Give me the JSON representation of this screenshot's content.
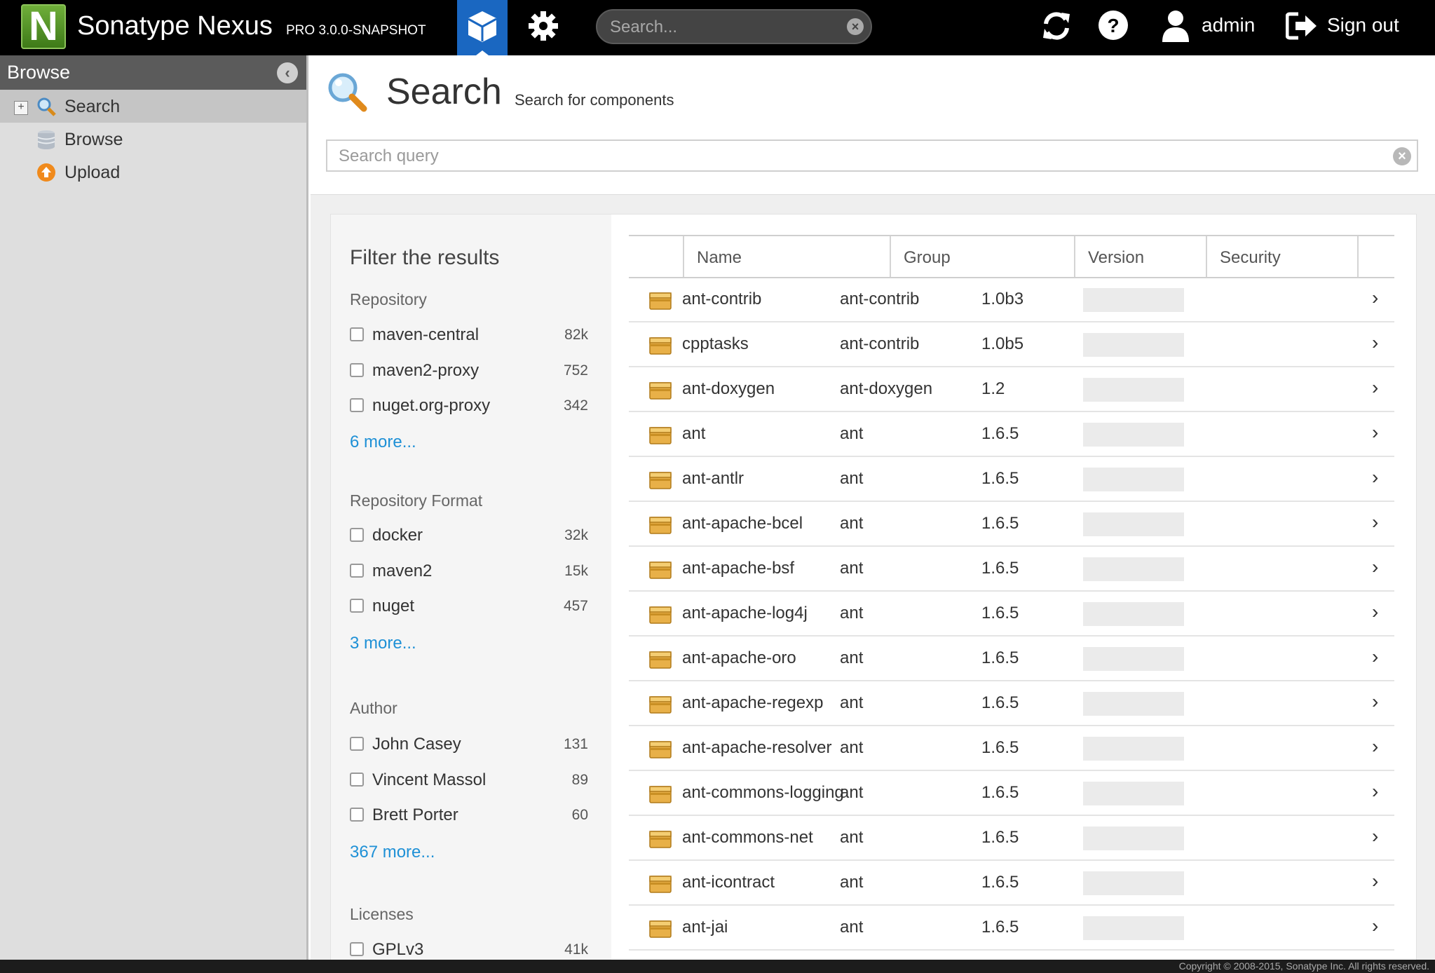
{
  "app": {
    "logo_letter": "N",
    "name": "Sonatype Nexus",
    "version": "PRO 3.0.0-SNAPSHOT"
  },
  "topbar": {
    "search_placeholder": "Search...",
    "user": "admin",
    "signout": "Sign out"
  },
  "sidebar": {
    "title": "Browse",
    "items": [
      {
        "label": "Search",
        "icon": "magnifier-icon",
        "selected": true
      },
      {
        "label": "Browse",
        "icon": "database-icon",
        "selected": false
      },
      {
        "label": "Upload",
        "icon": "upload-icon",
        "selected": false
      }
    ]
  },
  "main": {
    "title": "Search",
    "subtitle": "Search for components",
    "query_placeholder": "Search query"
  },
  "filters": {
    "title": "Filter the results",
    "groups": [
      {
        "name": "Repository",
        "options": [
          {
            "name": "maven-central",
            "count": "82k"
          },
          {
            "name": "maven2-proxy",
            "count": "752"
          },
          {
            "name": "nuget.org-proxy",
            "count": "342"
          }
        ],
        "more": "6 more..."
      },
      {
        "name": "Repository Format",
        "options": [
          {
            "name": "docker",
            "count": "32k"
          },
          {
            "name": "maven2",
            "count": "15k"
          },
          {
            "name": "nuget",
            "count": "457"
          }
        ],
        "more": "3 more..."
      },
      {
        "name": "Author",
        "options": [
          {
            "name": "John Casey",
            "count": "131"
          },
          {
            "name": "Vincent Massol",
            "count": "89"
          },
          {
            "name": "Brett Porter",
            "count": "60"
          }
        ],
        "more": "367 more..."
      },
      {
        "name": "Licenses",
        "options": [
          {
            "name": "GPLv3",
            "count": "41k"
          }
        ],
        "more": ""
      }
    ]
  },
  "results": {
    "columns": [
      "Name",
      "Group",
      "Version",
      "Security"
    ],
    "rows": [
      {
        "name": "ant-contrib",
        "group": "ant-contrib",
        "version": "1.0b3"
      },
      {
        "name": "cpptasks",
        "group": "ant-contrib",
        "version": "1.0b5"
      },
      {
        "name": "ant-doxygen",
        "group": "ant-doxygen",
        "version": "1.2"
      },
      {
        "name": "ant",
        "group": "ant",
        "version": "1.6.5"
      },
      {
        "name": "ant-antlr",
        "group": "ant",
        "version": "1.6.5"
      },
      {
        "name": "ant-apache-bcel",
        "group": "ant",
        "version": "1.6.5"
      },
      {
        "name": "ant-apache-bsf",
        "group": "ant",
        "version": "1.6.5"
      },
      {
        "name": "ant-apache-log4j",
        "group": "ant",
        "version": "1.6.5"
      },
      {
        "name": "ant-apache-oro",
        "group": "ant",
        "version": "1.6.5"
      },
      {
        "name": "ant-apache-regexp",
        "group": "ant",
        "version": "1.6.5"
      },
      {
        "name": "ant-apache-resolver",
        "group": "ant",
        "version": "1.6.5"
      },
      {
        "name": "ant-commons-logging",
        "group": "ant",
        "version": "1.6.5"
      },
      {
        "name": "ant-commons-net",
        "group": "ant",
        "version": "1.6.5"
      },
      {
        "name": "ant-icontract",
        "group": "ant",
        "version": "1.6.5"
      },
      {
        "name": "ant-jai",
        "group": "ant",
        "version": "1.6.5"
      }
    ]
  },
  "footer": {
    "copyright": "Copyright © 2008-2015, Sonatype Inc. All rights reserved."
  },
  "colors": {
    "accent": "#1a67c1",
    "link": "#1e90d6",
    "brand_green": "#5a9a2a"
  }
}
